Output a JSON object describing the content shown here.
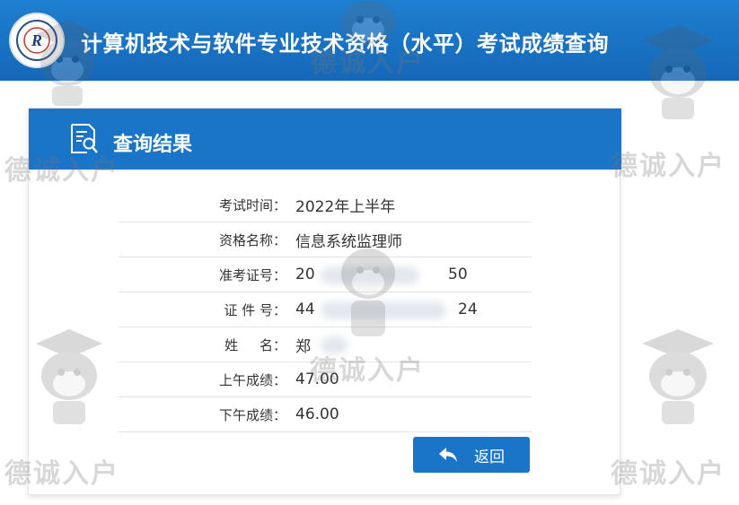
{
  "banner": {
    "title": "计算机技术与软件专业技术资格（水平）考试成绩查询",
    "logo_letters": "R"
  },
  "card": {
    "title": "查询结果"
  },
  "results": [
    {
      "label": "考试时间：",
      "value": "2022年上半年"
    },
    {
      "label": "资格名称：",
      "value": "信息系统监理师"
    },
    {
      "label": "准考证号：",
      "value": "20",
      "value_end": "50"
    },
    {
      "label": "证 件 号：",
      "value": "44",
      "value_end": "24"
    },
    {
      "label": "姓     名：",
      "value": "郑"
    },
    {
      "label": "上午成绩：",
      "value": "47.00"
    },
    {
      "label": "下午成绩：",
      "value": "46.00"
    }
  ],
  "back_button": {
    "label": "返回",
    "icon": "reply-arrow-icon"
  },
  "watermark": {
    "text": "德诚入户",
    "mascot_icon": "husky-mascot-icon"
  },
  "colors": {
    "banner": "#1567b8",
    "header": "#1a74c8",
    "button": "#1a74c8",
    "text": "#333333"
  }
}
